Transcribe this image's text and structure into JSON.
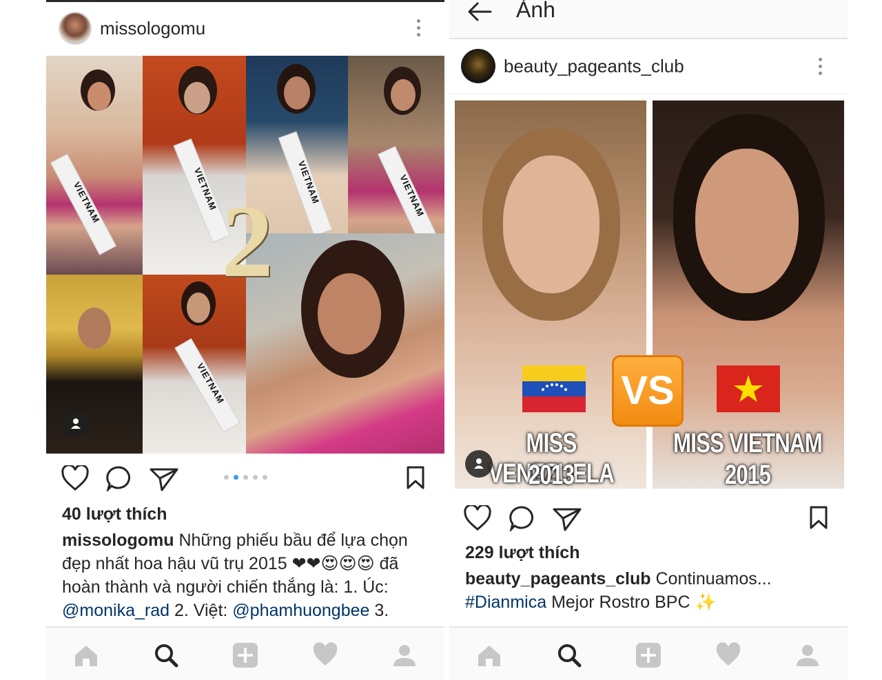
{
  "left_post": {
    "username": "missologomu",
    "overlay_number": "2",
    "sash_text": "VIETNAM",
    "carousel": {
      "count": 5,
      "active_index": 1
    },
    "likes": "40 lượt thích",
    "caption": {
      "username": "missologomu",
      "text_1": "Những phiếu bầu để lựa chọn đẹp nhất hoa hậu vũ trụ 2015 ❤❤",
      "emoji": "😍😍😍",
      "text_2": "đã hoàn thành và người chiến thắng là: 1. Úc: ",
      "mention_1": "@monika_rad",
      "text_3": " 2. Việt: ",
      "mention_2": "@phamhuongbee",
      "text_4": " 3."
    }
  },
  "right_post": {
    "appbar_title": "Ảnh",
    "username": "beauty_pageants_club",
    "vs_label": "VS",
    "left_name": "MISS VENEZUELA",
    "left_year": "2013",
    "right_name": "MISS VIETNAM",
    "right_year": "2015",
    "likes": "229 lượt thích",
    "caption": {
      "username": "beauty_pageants_club",
      "text": "Continuamos...",
      "hashtag": "#Dianmica",
      "text_2": "Mejor Rostro BPC",
      "emoji": "✨"
    }
  },
  "icons": {
    "heart": "heart-icon",
    "comment": "comment-icon",
    "share": "send-icon",
    "save": "bookmark-icon",
    "home": "home-icon",
    "search": "search-icon",
    "add": "add-icon",
    "activity": "heart-icon",
    "profile": "profile-icon"
  },
  "colors": {
    "link": "#003569",
    "carousel_active": "#3897f0",
    "icon_gray": "#c7c7c7",
    "text": "#262626"
  }
}
